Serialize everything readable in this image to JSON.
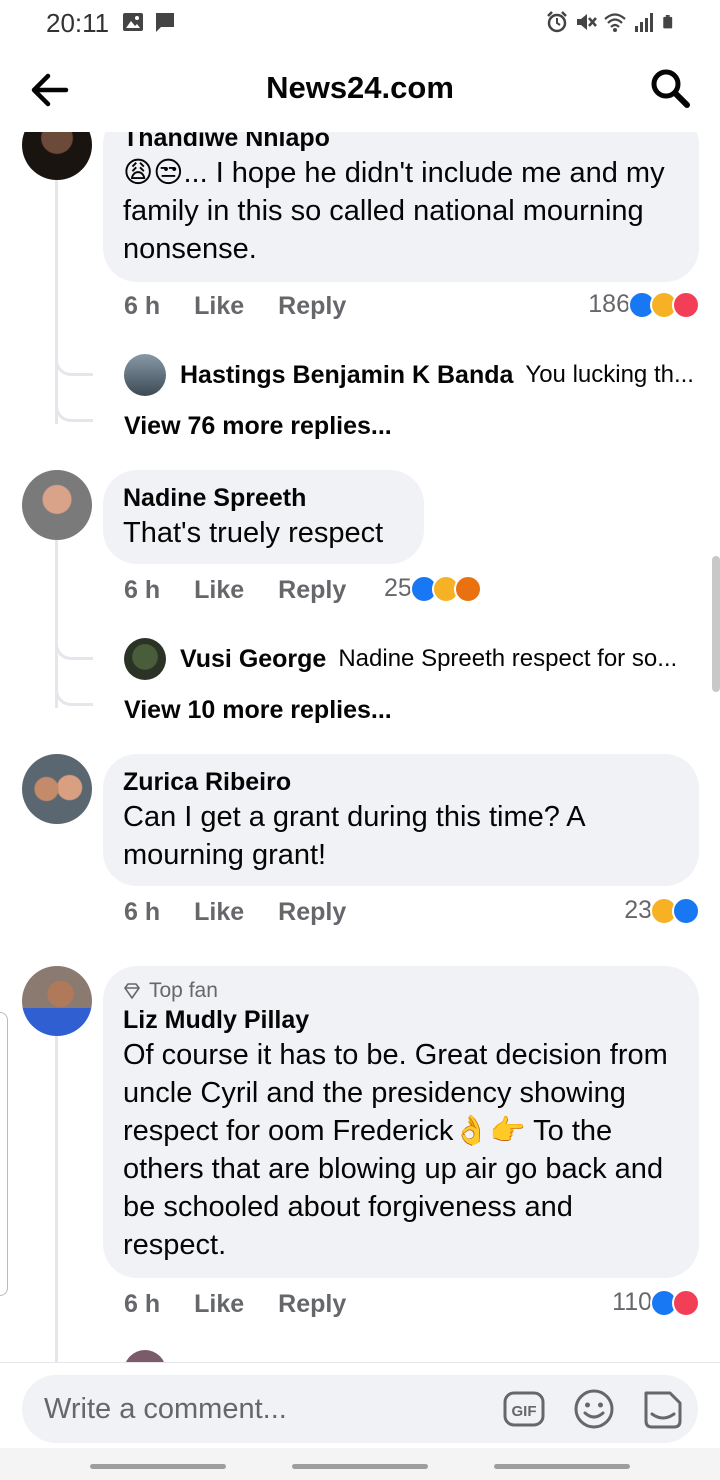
{
  "status_bar": {
    "time": "20:11",
    "left_icons": [
      "image-icon",
      "message-icon"
    ],
    "right_icons": [
      "alarm-icon",
      "mute-icon",
      "wifi-icon",
      "signal-icon",
      "battery-icon"
    ]
  },
  "app_bar": {
    "title": "News24.com",
    "back_icon": "arrow-left-icon",
    "search_icon": "search-icon"
  },
  "comments": [
    {
      "author": "Thandiwe Nhlapo",
      "text": "😩😒... I hope he didn't include me and my family in this so called national mourning nonsense.",
      "time": "6 h",
      "like_label": "Like",
      "reply_label": "Reply",
      "reaction_count": "186",
      "reactions": [
        "like",
        "haha",
        "love"
      ],
      "reply_preview": {
        "author": "Hastings Benjamin K Banda",
        "snippet": "You lucking th..."
      },
      "view_more": "View 76 more replies..."
    },
    {
      "author": "Nadine Spreeth",
      "text": "That's truely respect",
      "time": "6 h",
      "like_label": "Like",
      "reply_label": "Reply",
      "reaction_count": "25",
      "reactions": [
        "like",
        "haha",
        "angry"
      ],
      "reply_preview": {
        "author": "Vusi George",
        "snippet": "Nadine Spreeth respect for so..."
      },
      "view_more": "View 10 more replies..."
    },
    {
      "author": "Zurica Ribeiro",
      "text": "Can I get a grant during this time? A mourning grant!",
      "time": "6 h",
      "like_label": "Like",
      "reply_label": "Reply",
      "reaction_count": "23",
      "reactions": [
        "haha",
        "like"
      ]
    },
    {
      "badge": "Top fan",
      "author": "Liz Mudly Pillay",
      "text": "Of course it has to be.  Great decision from uncle Cyril and the presidency showing respect for oom Frederick👌👉 To the others that are blowing up air go back and be schooled about forgiveness and respect.",
      "time": "6 h",
      "like_label": "Like",
      "reply_label": "Reply",
      "reaction_count": "110",
      "reactions": [
        "like",
        "love"
      ]
    }
  ],
  "composer": {
    "placeholder": "Write a comment...",
    "gif_label": "GIF"
  },
  "colors": {
    "bubble": "#f0f2f5",
    "secondary_text": "#65676b",
    "like_blue": "#1877f2",
    "love_red": "#f33e58",
    "haha_yellow": "#f7b125",
    "angry_orange": "#e9710f"
  }
}
